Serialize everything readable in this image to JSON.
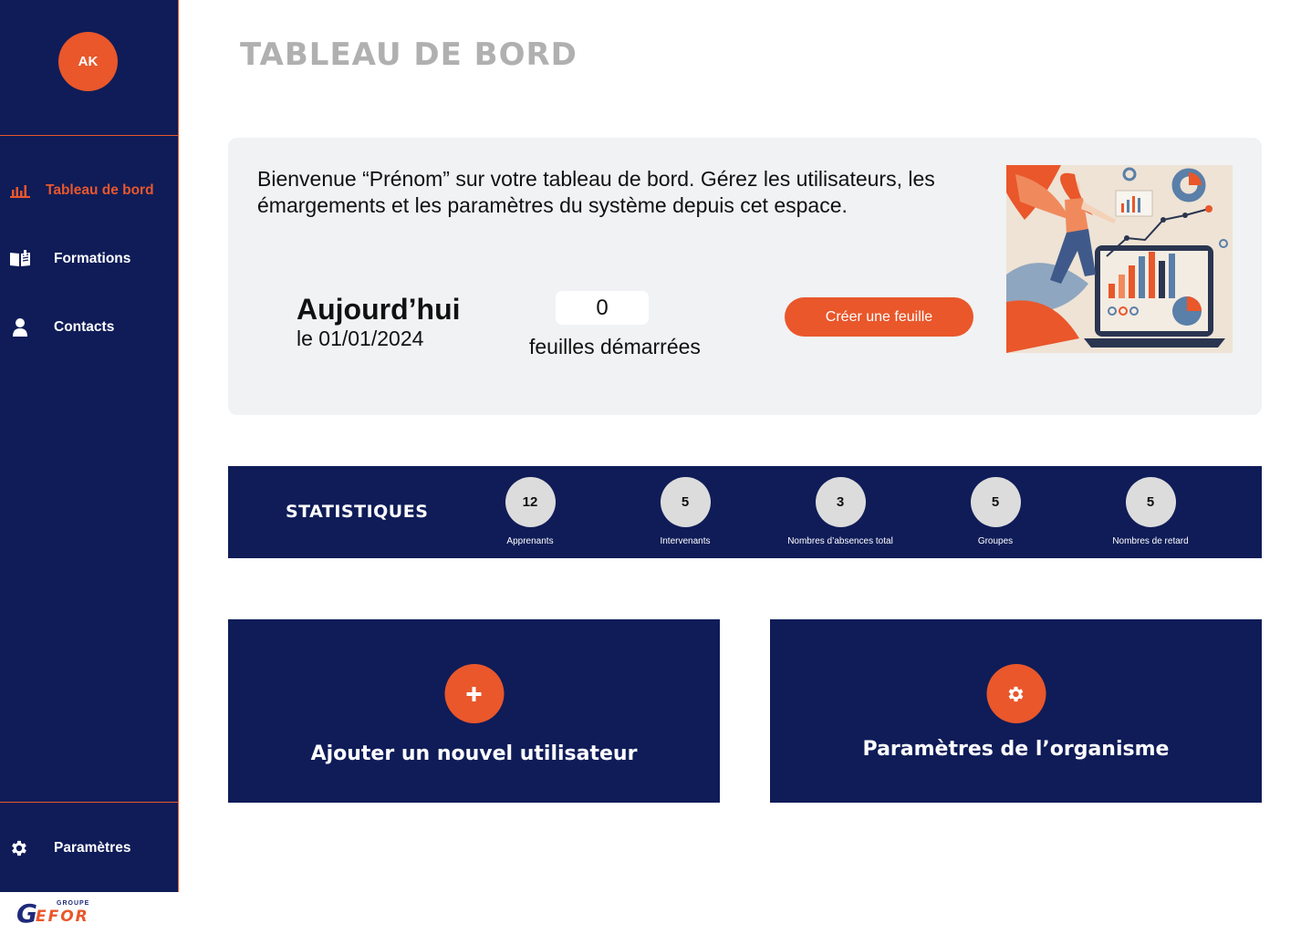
{
  "user": {
    "initials": "AK"
  },
  "sidebar": {
    "items": [
      {
        "label": "Tableau de bord",
        "icon": "bar-chart-icon",
        "active": true
      },
      {
        "label": "Formations",
        "icon": "book-icon"
      },
      {
        "label": "Contacts",
        "icon": "person-icon"
      }
    ],
    "settings": {
      "label": "Paramètres",
      "icon": "gear-icon"
    },
    "logo": {
      "main": "G",
      "small": "GROUPE",
      "brand": "EFOR"
    }
  },
  "header": {
    "title": "TABLEAU DE BORD"
  },
  "welcome": {
    "text": "Bienvenue “Prénom” sur votre tableau de bord. Gérez les utilisateurs, les émargements et les paramètres du système depuis cet espace.",
    "today_title": "Aujourd’hui",
    "today_date": "le 01/01/2024",
    "sheets_count": "0",
    "sheets_label": "feuilles démarrées",
    "create_button": "Créer une feuille"
  },
  "stats": {
    "title": "STATISTIQUES",
    "items": [
      {
        "value": "12",
        "label": "Apprenants"
      },
      {
        "value": "5",
        "label": "Intervenants"
      },
      {
        "value": "3",
        "label": "Nombres d’absences total"
      },
      {
        "value": "5",
        "label": "Groupes"
      },
      {
        "value": "5",
        "label": "Nombres de retard"
      }
    ]
  },
  "actions": {
    "add_user": {
      "label": "Ajouter un nouvel utilisateur",
      "icon": "plus-icon"
    },
    "org_settings": {
      "label": "Paramètres de l’organisme",
      "icon": "gear-icon"
    }
  },
  "colors": {
    "navy": "#0f1c58",
    "accent": "#e9572b",
    "panel": "#f1f2f4",
    "title_gray": "#b0b0b0"
  }
}
